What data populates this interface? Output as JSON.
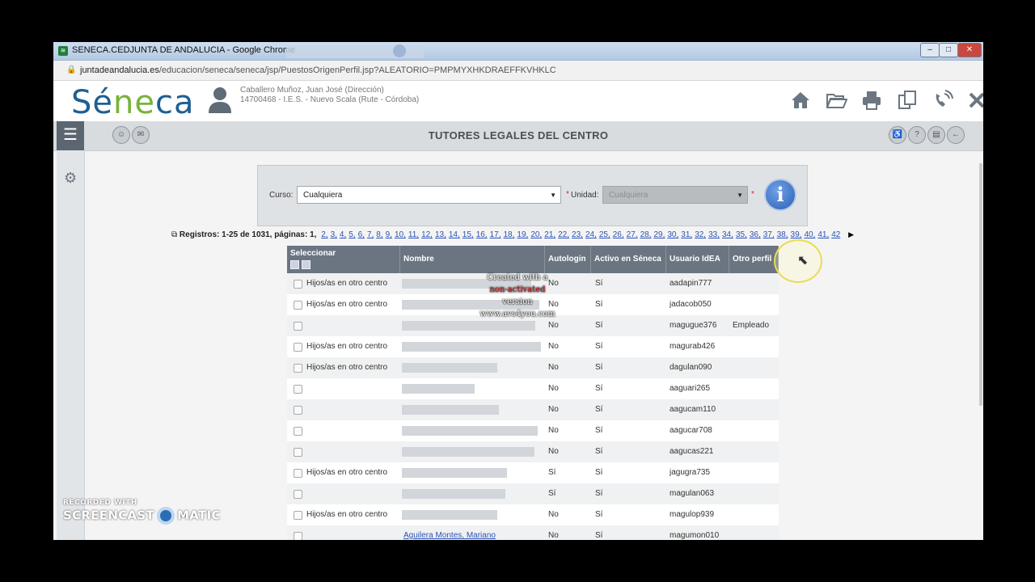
{
  "window": {
    "title": "SENECA.CEDJUNTA DE ANDALUCIA - Google Chrome",
    "url_domain": "juntadeandalucia.es",
    "url_path": "/educacion/seneca/seneca/jsp/PuestosOrigenPerfil.jsp?ALEATORIO=PMPMYXHKDRAEFFKVHKLC",
    "controls": {
      "minimize": "–",
      "maximize": "□",
      "close": "✕"
    }
  },
  "header": {
    "logo_pre": "Sé",
    "logo_accent": "ne",
    "logo_post": "ca",
    "user_name": "Caballero Muñoz, Juan José (Dirección)",
    "user_center": "14700468 - I.E.S. - Nuevo Scala (Rute - Córdoba)",
    "icons": [
      "home-icon",
      "folder-open-icon",
      "print-icon",
      "copy-icon",
      "phone-icon",
      "close-icon"
    ]
  },
  "toolbar": {
    "page_title": "TUTORES LEGALES DEL CENTRO"
  },
  "filter": {
    "curso_label": "Curso:",
    "curso_value": "Cualquiera",
    "unidad_label": "Unidad:",
    "unidad_value": "Cualquiera",
    "required_mark": "*",
    "info_glyph": "i"
  },
  "pagination": {
    "label": "Registros: 1-25 de 1031, páginas:",
    "current": "1,",
    "pages": [
      "2,",
      "3,",
      "4,",
      "5,",
      "6,",
      "7,",
      "8,",
      "9,",
      "10,",
      "11,",
      "12,",
      "13,",
      "14,",
      "15,",
      "16,",
      "17,",
      "18,",
      "19,",
      "20,",
      "21,",
      "22,",
      "23,",
      "24,",
      "25,",
      "26,",
      "27,",
      "28,",
      "29,",
      "30,",
      "31,",
      "32,",
      "33,",
      "34,",
      "35,",
      "36,",
      "37,",
      "38,",
      "39,",
      "40,",
      "41,",
      "42"
    ],
    "next": "▶"
  },
  "table": {
    "columns": [
      "Seleccionar",
      "Nombre",
      "Autologin",
      "Activo en Séneca",
      "Usuario IdEA",
      "Otro perfil"
    ],
    "rows": [
      {
        "sel": "Hijos/as en otro centro",
        "nombre": "",
        "autologin": "No",
        "activo": "Sí",
        "usuario": "aadapin777",
        "otro": ""
      },
      {
        "sel": "Hijos/as en otro centro",
        "nombre": "",
        "autologin": "No",
        "activo": "Sí",
        "usuario": "jadacob050",
        "otro": ""
      },
      {
        "sel": "",
        "nombre": "",
        "autologin": "No",
        "activo": "Sí",
        "usuario": "magugue376",
        "otro": "Empleado"
      },
      {
        "sel": "Hijos/as en otro centro",
        "nombre": "",
        "autologin": "No",
        "activo": "Sí",
        "usuario": "magurab426",
        "otro": ""
      },
      {
        "sel": "Hijos/as en otro centro",
        "nombre": "",
        "autologin": "No",
        "activo": "Sí",
        "usuario": "dagulan090",
        "otro": ""
      },
      {
        "sel": "",
        "nombre": "",
        "autologin": "No",
        "activo": "Sí",
        "usuario": "aaguari265",
        "otro": ""
      },
      {
        "sel": "",
        "nombre": "",
        "autologin": "No",
        "activo": "Sí",
        "usuario": "aagucam110",
        "otro": ""
      },
      {
        "sel": "",
        "nombre": "",
        "autologin": "No",
        "activo": "Sí",
        "usuario": "aagucar708",
        "otro": ""
      },
      {
        "sel": "",
        "nombre": "",
        "autologin": "No",
        "activo": "Sí",
        "usuario": "aagucas221",
        "otro": ""
      },
      {
        "sel": "Hijos/as en otro centro",
        "nombre": "",
        "autologin": "Sí",
        "activo": "Sí",
        "usuario": "jagugra735",
        "otro": ""
      },
      {
        "sel": "",
        "nombre": "",
        "autologin": "Sí",
        "activo": "Sí",
        "usuario": "magulan063",
        "otro": ""
      },
      {
        "sel": "Hijos/as en otro centro",
        "nombre": "",
        "autologin": "No",
        "activo": "Sí",
        "usuario": "magulop939",
        "otro": ""
      },
      {
        "sel": "",
        "nombre": "Aguilera Montes, Mariano",
        "autologin": "No",
        "activo": "Sí",
        "usuario": "magumon010",
        "otro": ""
      }
    ]
  },
  "overlays": {
    "watermark_line1": "Created with a",
    "watermark_line2_red": "non-activated",
    "watermark_line2_rest": " version",
    "watermark_line3": "www.avs4you.com",
    "recorder_line1": "RECORDED WITH",
    "recorder_left": "SCREENCAST",
    "recorder_right": "MATIC"
  }
}
